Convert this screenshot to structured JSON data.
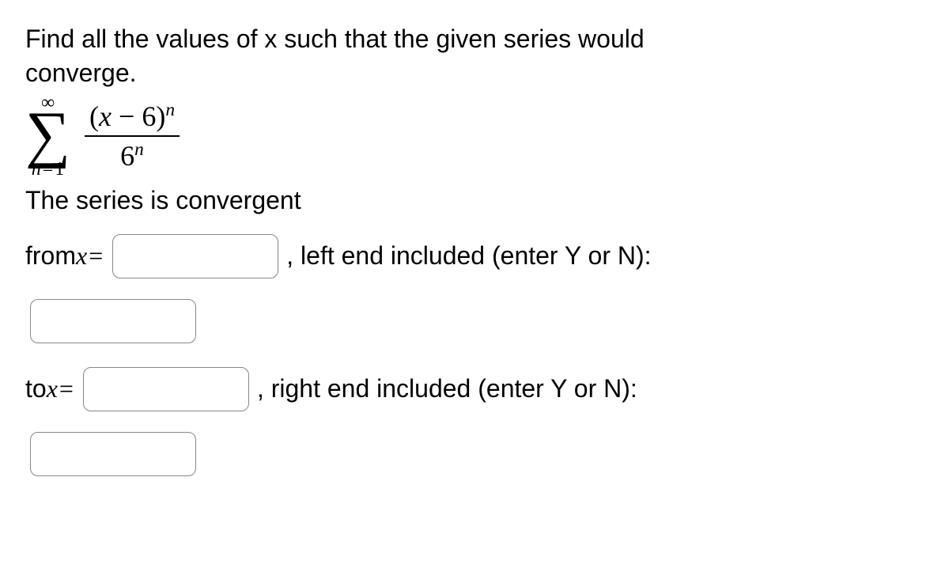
{
  "problem": {
    "line1": "Find all the values of x such that the given series would",
    "line2": "converge."
  },
  "formula": {
    "sigma_top": "∞",
    "sigma_bottom_var": "n",
    "sigma_bottom_eq": "=",
    "sigma_bottom_num": "1",
    "num_open": "(",
    "num_var": "x",
    "num_minus": " − ",
    "num_const": "6",
    "num_close": ")",
    "num_sup": "n",
    "den_base": "6",
    "den_sup": "n"
  },
  "convergent_text": "The series is convergent",
  "from": {
    "prefix": "from ",
    "var": "x",
    "eq": " =",
    "suffix": ", left end included (enter Y or N):"
  },
  "to": {
    "prefix": "to ",
    "var": "x",
    "eq": " =",
    "suffix": ", right end included (enter Y or N):"
  }
}
